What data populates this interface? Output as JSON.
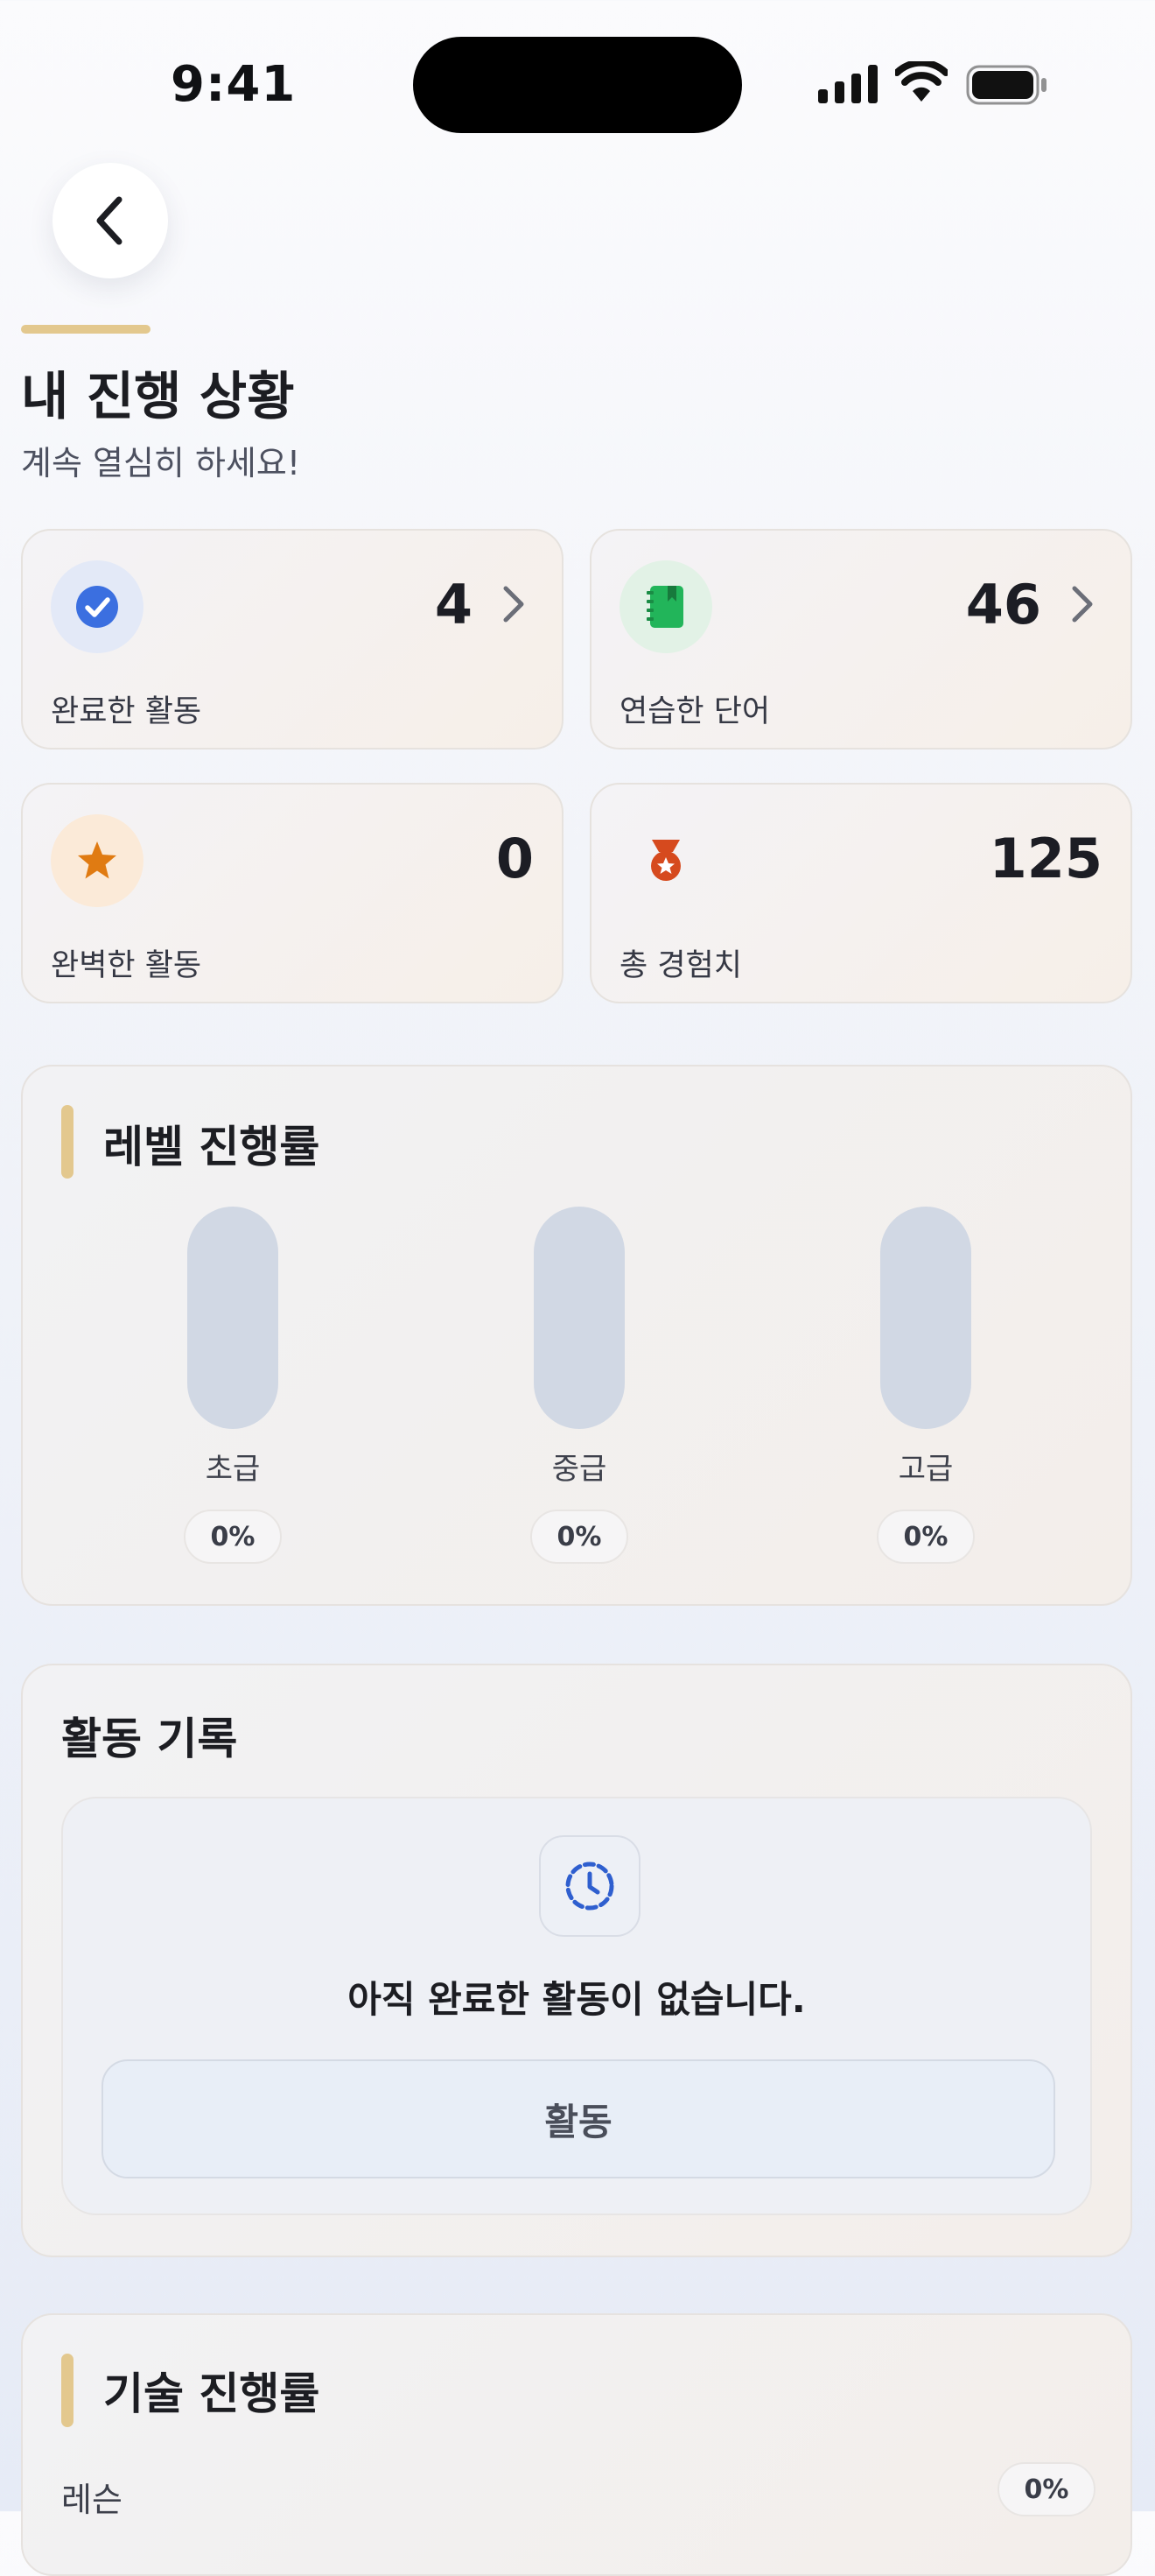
{
  "status_bar": {
    "time": "9:41"
  },
  "header": {
    "title": "내 진행 상황",
    "subtitle": "계속 열심히 하세요!"
  },
  "stats": [
    {
      "label": "완료한 활동",
      "value": "4",
      "icon": "check-circle-icon",
      "color": "#3b6fe0"
    },
    {
      "label": "연습한 단어",
      "value": "46",
      "icon": "book-icon",
      "color": "#22b55a"
    },
    {
      "label": "완벽한 활동",
      "value": "0",
      "icon": "star-icon",
      "color": "#e07b12"
    },
    {
      "label": "총 경험치",
      "value": "125",
      "icon": "medal-icon",
      "color": "#d64a1e"
    }
  ],
  "level_progress": {
    "title": "레벨 진행률",
    "levels": [
      {
        "name": "초급",
        "percent": "0%",
        "fill": 0
      },
      {
        "name": "중급",
        "percent": "0%",
        "fill": 0
      },
      {
        "name": "고급",
        "percent": "0%",
        "fill": 0
      }
    ]
  },
  "activity_log": {
    "title": "활동 기록",
    "empty_message": "아직 완료한 활동이 없습니다.",
    "button_label": "활동",
    "icon": "clock-history-icon"
  },
  "skill_progress": {
    "title": "기술 진행률",
    "items": [
      {
        "label": "레슨",
        "percent": "0%"
      }
    ]
  },
  "colors": {
    "accent_gold": "#e3c88e",
    "primary_blue": "#3b6fe0",
    "pill_gray": "#d1d8e4"
  }
}
